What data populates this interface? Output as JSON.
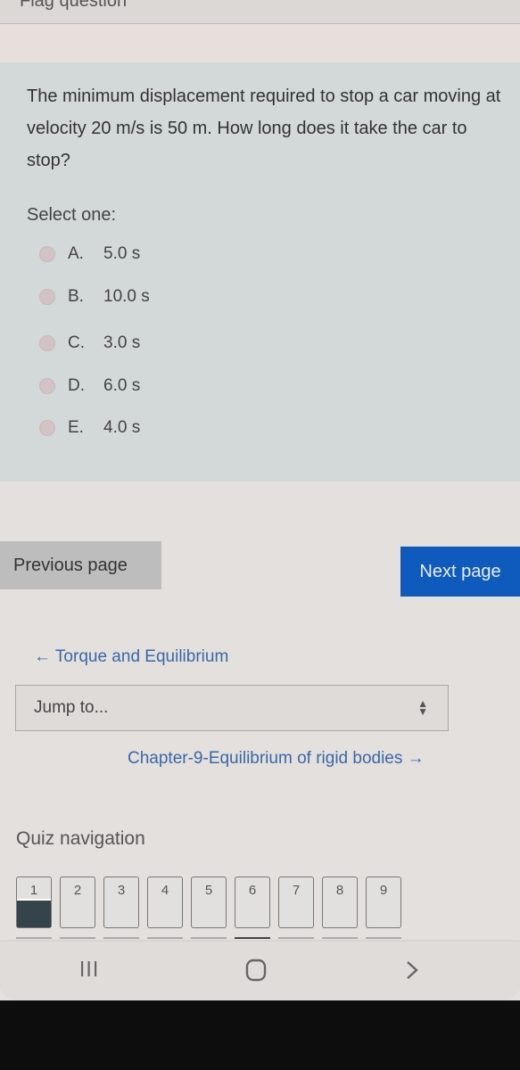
{
  "header": {
    "flag_label": "Flag question"
  },
  "question": {
    "text": "The minimum displacement required to stop a car moving at velocity 20 m/s is 50 m. How long does it take the car to stop?",
    "select_label": "Select one:",
    "options": [
      {
        "letter": "A.",
        "value": "5.0 s",
        "selected": false
      },
      {
        "letter": "B.",
        "value": "10.0 s",
        "selected": false
      },
      {
        "letter": "C.",
        "value": "3.0 s",
        "selected": false
      },
      {
        "letter": "D.",
        "value": "6.0 s",
        "selected": false
      },
      {
        "letter": "E.",
        "value": "4.0 s",
        "selected": false
      }
    ]
  },
  "pagination": {
    "previous_label": "Previous page",
    "next_label": "Next page"
  },
  "activity_nav": {
    "previous_link": "← Torque and Equilibrium",
    "jump_placeholder": "Jump to...",
    "next_link": "Chapter-9-Equilibrium of rigid bodies →"
  },
  "quiz_navigation": {
    "title": "Quiz navigation",
    "questions": [
      {
        "number": "1",
        "answered": true,
        "current": false
      },
      {
        "number": "2",
        "answered": false,
        "current": false
      },
      {
        "number": "3",
        "answered": false,
        "current": false
      },
      {
        "number": "4",
        "answered": false,
        "current": false
      },
      {
        "number": "5",
        "answered": false,
        "current": false
      },
      {
        "number": "6",
        "answered": false,
        "current": true
      },
      {
        "number": "7",
        "answered": false,
        "current": false
      },
      {
        "number": "8",
        "answered": false,
        "current": false
      },
      {
        "number": "9",
        "answered": false,
        "current": false
      }
    ]
  },
  "system_nav": {
    "recents_icon": "recents-icon",
    "home_icon": "home-icon",
    "back_icon": "back-icon"
  },
  "colors": {
    "next_button": "#0f5bbd",
    "link": "#3a68a7",
    "answered_fill": "#35434b",
    "question_card": "#d3d8d8"
  }
}
